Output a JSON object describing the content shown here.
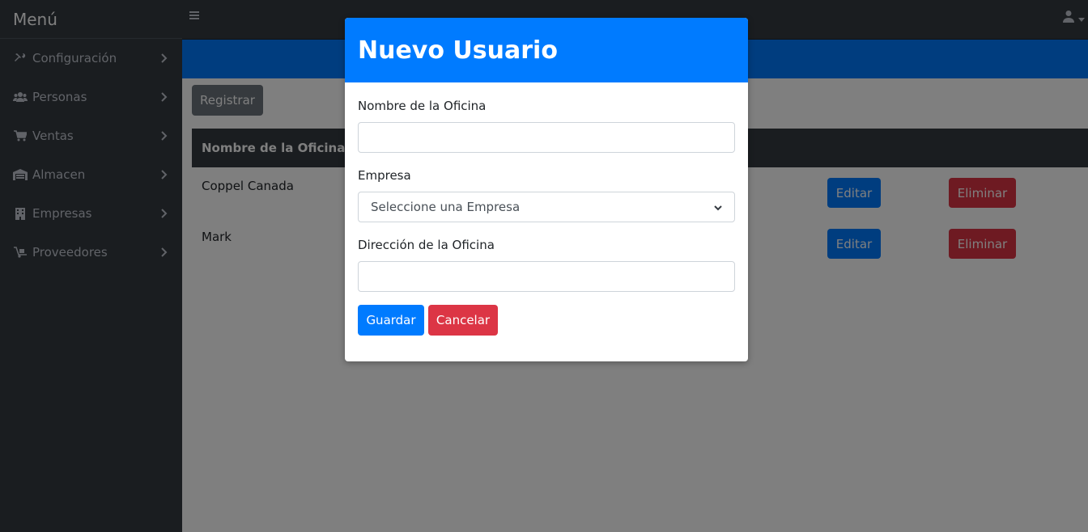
{
  "sidebar": {
    "brand": "Menú",
    "items": [
      {
        "label": "Configuración",
        "icon": "tools-icon"
      },
      {
        "label": "Personas",
        "icon": "users-icon"
      },
      {
        "label": "Ventas",
        "icon": "cart-icon"
      },
      {
        "label": "Almacen",
        "icon": "warehouse-icon"
      },
      {
        "label": "Empresas",
        "icon": "building-icon"
      },
      {
        "label": "Proveedores",
        "icon": "dolly-icon"
      }
    ]
  },
  "page": {
    "register_label": "Registrar",
    "table": {
      "header": "Nombre de la Oficina",
      "rows": [
        {
          "name": "Coppel Canada",
          "edit": "Editar",
          "delete": "Eliminar"
        },
        {
          "name": "Mark",
          "edit": "Editar",
          "delete": "Eliminar"
        }
      ]
    }
  },
  "modal": {
    "title": "Nuevo Usuario",
    "office_name_label": "Nombre de la Oficina",
    "office_name_value": "",
    "company_label": "Empresa",
    "company_selected": "Seleccione una Empresa",
    "address_label": "Dirección de la Oficina",
    "address_value": "",
    "save_label": "Guardar",
    "cancel_label": "Cancelar"
  },
  "colors": {
    "primary": "#007bff",
    "danger": "#dc3545",
    "secondary": "#6c757d",
    "dark": "#343a40"
  }
}
